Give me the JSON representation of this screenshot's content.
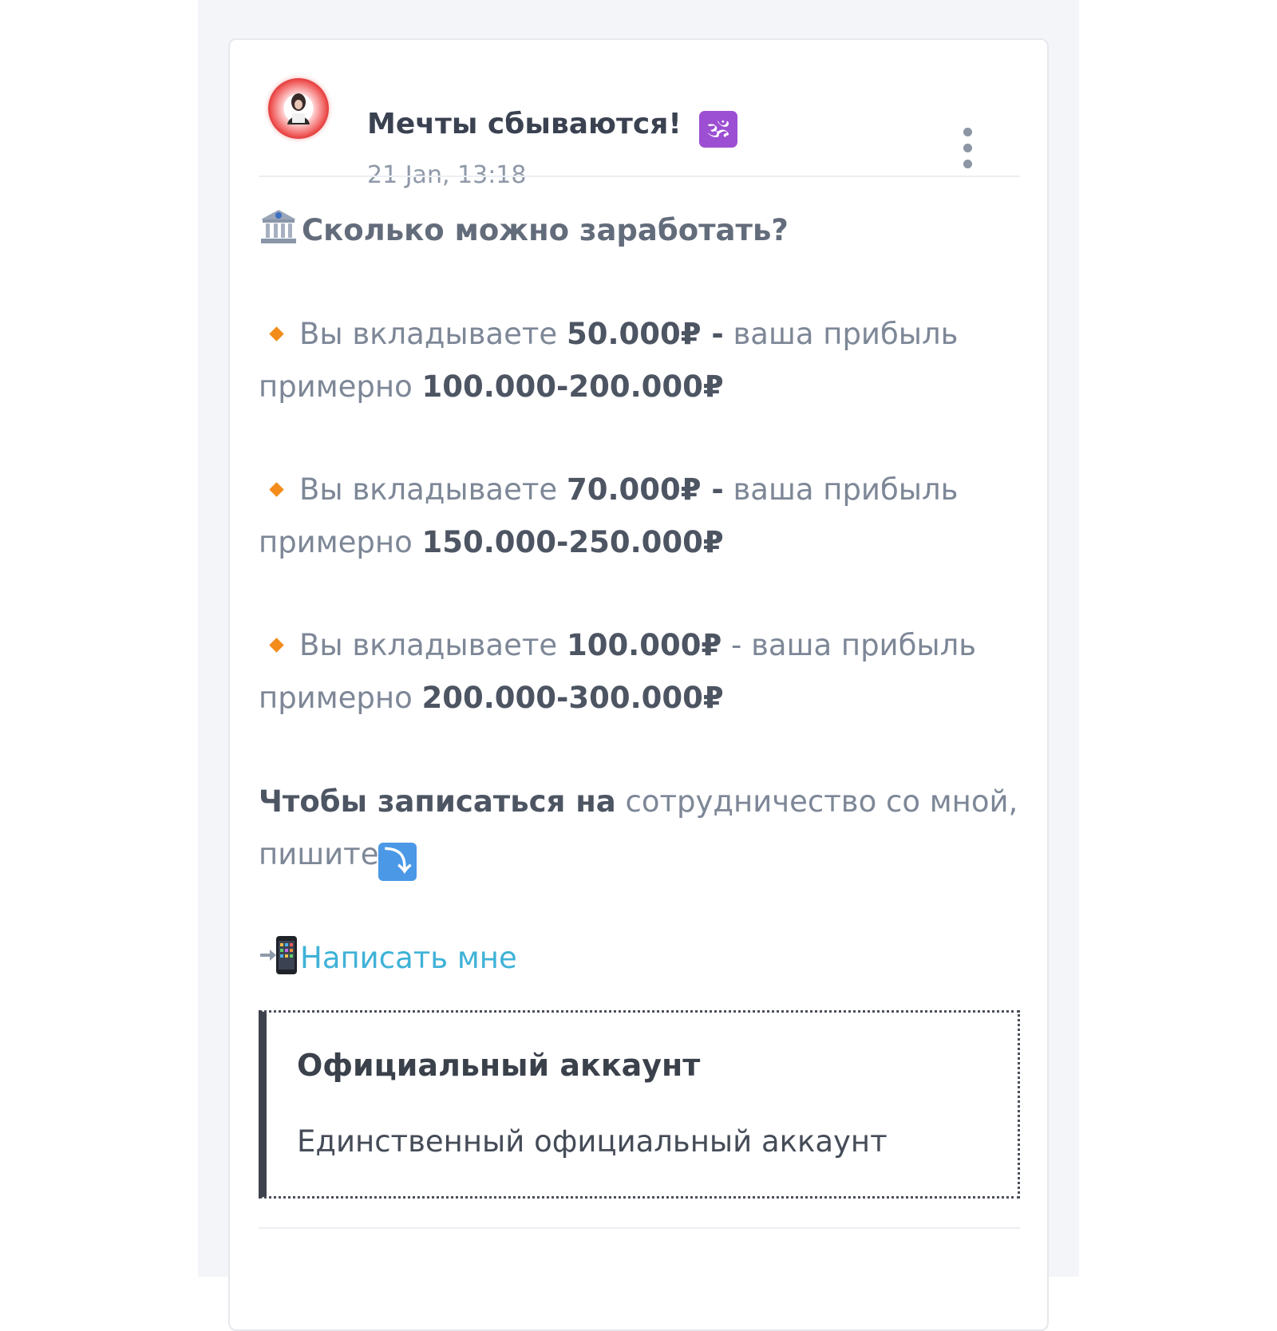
{
  "post": {
    "channel_name": "Мечты сбываются!",
    "channel_emoji": "🕉",
    "date": "21 Jan, 13:18",
    "heading": "Сколько можно заработать?",
    "offers": [
      {
        "prefix": "Вы вкладываете ",
        "amount": "50.000₽ -",
        "middle": " ваша прибыль примерно ",
        "profit": "100.000-200.000₽"
      },
      {
        "prefix": "Вы вкладываете ",
        "amount": "70.000₽ -",
        "middle": " ваша прибыль примерно ",
        "profit": "150.000-250.000₽"
      },
      {
        "prefix": "Вы вкладываете ",
        "amount": "100.000₽",
        "middle": " - ваша прибыль примерно ",
        "profit": "200.000-300.000₽"
      }
    ],
    "cta_bold": "Чтобы записаться на",
    "cta_rest": " сотрудничество со мной, пишите",
    "cta_arrow": "⤵",
    "link_label": "Написать мне",
    "quote": {
      "title": "Официальный аккаунт",
      "text": "Единственный официальный аккаунт"
    }
  },
  "icons": {
    "avatar": "avatar",
    "channel_emoji": "om-icon",
    "bank": "bank-icon",
    "bullet": "orange-diamond-icon",
    "arrow": "arrow-down-right-icon",
    "phone": "phone-with-arrow-icon",
    "menu": "more-vertical-icon"
  },
  "colors": {
    "link": "#3fb2d7",
    "bullet": "#f38c1a",
    "quote_bar": "#3d424c"
  }
}
